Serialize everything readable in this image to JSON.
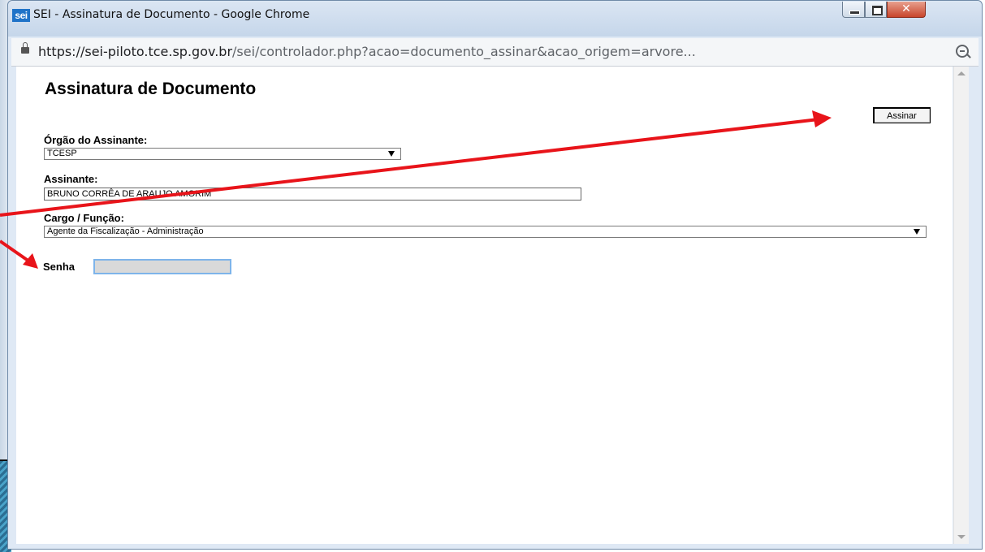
{
  "window": {
    "logo_text": "sei",
    "title": "SEI - Assinatura de Documento - Google Chrome"
  },
  "address": {
    "url_host": "https://sei-piloto.tce.sp.gov.br",
    "url_path": "/sei/controlador.php?acao=documento_assinar&acao_origem=arvore..."
  },
  "form": {
    "heading": "Assinatura de Documento",
    "sign_button": "Assinar",
    "orgao_label": "Órgão do Assinante:",
    "orgao_value": "TCESP",
    "assinante_label": "Assinante:",
    "assinante_value": "BRUNO CORRÊA DE ARAUJO AMORIM",
    "cargo_label": "Cargo / Função:",
    "cargo_value": "Agente da Fiscalização - Administração",
    "senha_label": "Senha",
    "senha_value": ""
  },
  "icons": {
    "lock": "lock-icon",
    "zoom": "zoom-out-icon",
    "close": "close-icon"
  },
  "colors": {
    "annotation_arrow": "#e8141a",
    "focus_border": "#7eb4ea"
  }
}
